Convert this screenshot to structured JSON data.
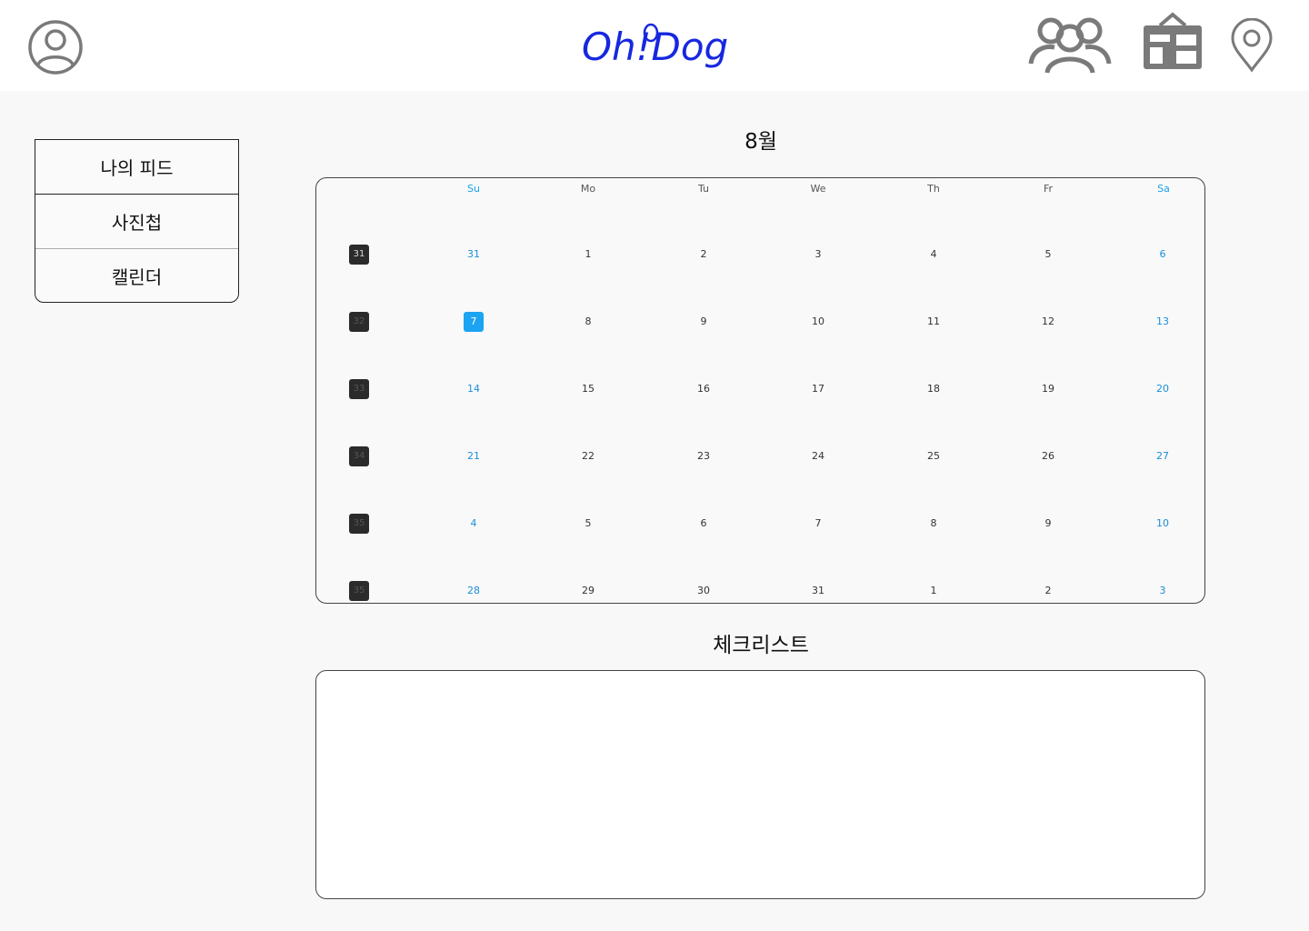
{
  "header": {
    "logo_text": "Oh!Dog",
    "brand_color": "#1727e0",
    "icons": [
      "user-profile-icon",
      "friends-group-icon",
      "board-news-icon",
      "map-pin-icon"
    ]
  },
  "side_menu": {
    "items": [
      {
        "label": "나의 피드"
      },
      {
        "label": "사진첩"
      },
      {
        "label": "캘린더"
      }
    ]
  },
  "calendar": {
    "month_title": "8월",
    "weekdays": [
      "Su",
      "Mo",
      "Tu",
      "We",
      "Th",
      "Fr",
      "Sa"
    ],
    "week_numbers": [
      "31",
      "32",
      "33",
      "34",
      "35",
      "35"
    ],
    "selected_day": "7",
    "accent_color": "#1ca3f2",
    "weeks": [
      [
        "31",
        "1",
        "2",
        "3",
        "4",
        "5",
        "6"
      ],
      [
        "7",
        "8",
        "9",
        "10",
        "11",
        "12",
        "13"
      ],
      [
        "14",
        "15",
        "16",
        "17",
        "18",
        "19",
        "20"
      ],
      [
        "21",
        "22",
        "23",
        "24",
        "25",
        "26",
        "27"
      ],
      [
        "4",
        "5",
        "6",
        "7",
        "8",
        "9",
        "10"
      ],
      [
        "28",
        "29",
        "30",
        "31",
        "1",
        "2",
        "3"
      ]
    ]
  },
  "checklist": {
    "title": "체크리스트"
  }
}
